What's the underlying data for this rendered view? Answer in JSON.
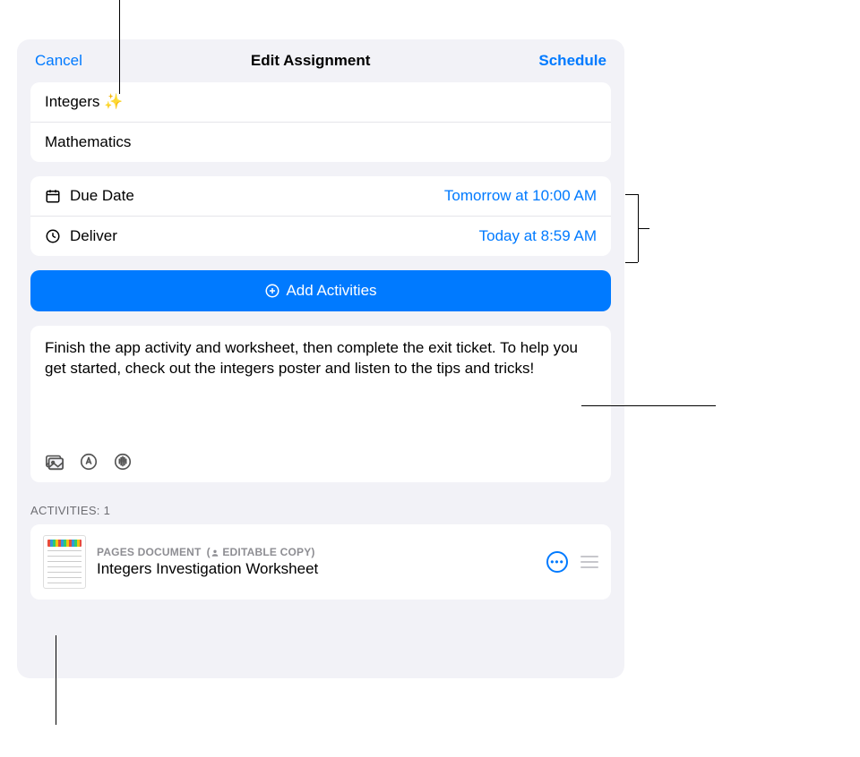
{
  "header": {
    "cancel_label": "Cancel",
    "title": "Edit Assignment",
    "schedule_label": "Schedule"
  },
  "title_card": {
    "title": "Integers ✨",
    "subject": "Mathematics"
  },
  "date_card": {
    "due_label": "Due Date",
    "due_value": "Tomorrow at 10:00 AM",
    "deliver_label": "Deliver",
    "deliver_value": "Today at 8:59 AM"
  },
  "add_activities_label": "Add Activities",
  "instructions": "Finish the app activity and worksheet, then complete the exit ticket. To help you get started, check out the integers poster and listen to the tips and tricks!",
  "activities": {
    "section_label": "ACTIVITIES: 1",
    "item": {
      "type_label": "PAGES DOCUMENT",
      "copy_label": "EDITABLE COPY",
      "title": "Integers Investigation Worksheet"
    }
  }
}
